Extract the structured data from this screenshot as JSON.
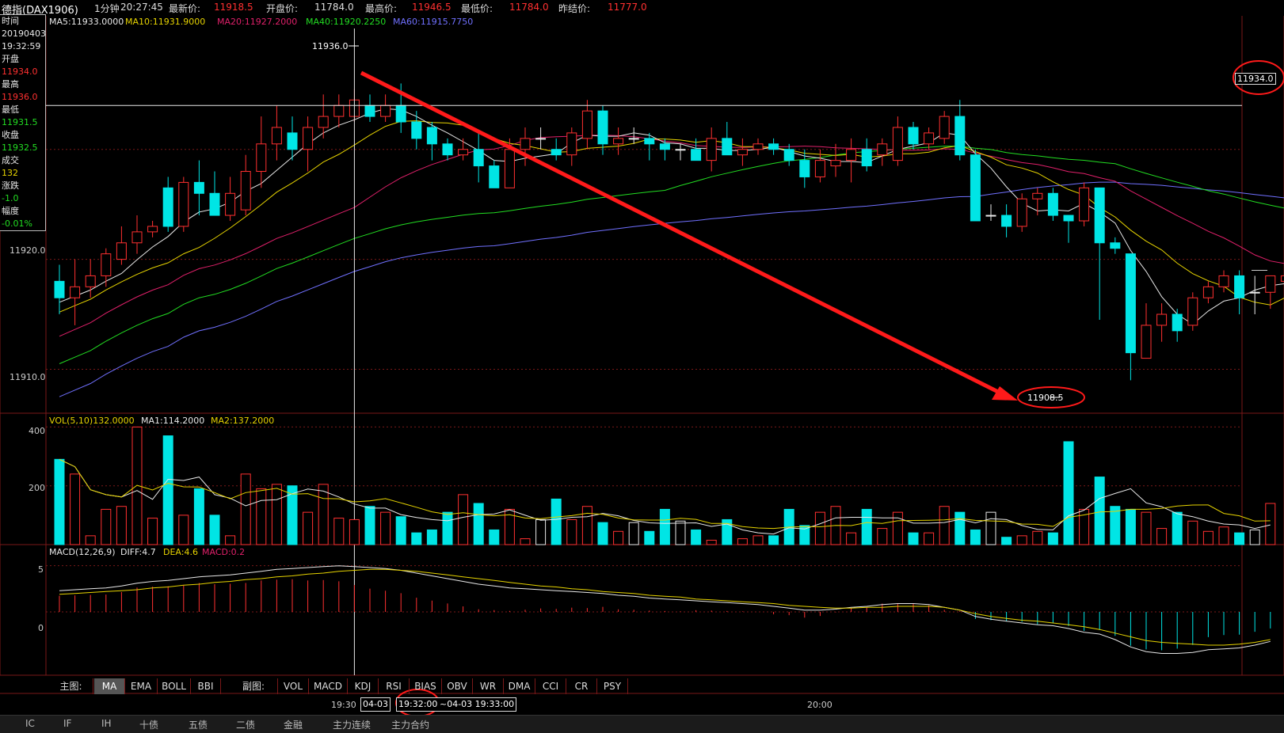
{
  "header": {
    "symbol": "德指(DAX1906)",
    "period": "1分钟",
    "time": "20:27:45",
    "latest_label": "最新价:",
    "latest": "11918.5",
    "open_label": "开盘价:",
    "open": "11784.0",
    "high_label": "最高价:",
    "high": "11946.5",
    "low_label": "最低价:",
    "low": "11784.0",
    "prev_label": "昨结价:",
    "prev": "11777.0"
  },
  "ma_legend": {
    "ma5": "MA5:11933.0000",
    "ma10": "MA10:11931.9000",
    "ma20": "MA20:11927.2000",
    "ma40": "MA40:11920.2250",
    "ma60": "MA60:11915.7750"
  },
  "info_box": {
    "time_label": "时间",
    "date": "20190403",
    "time": "19:32:59",
    "open_label": "开盘",
    "open": "11934.0",
    "high_label": "最高",
    "high": "11936.0",
    "low_label": "最低",
    "low": "11931.5",
    "close_label": "收盘",
    "close": "11932.5",
    "volume_label": "成交",
    "volume": "132",
    "change_label": "涨跌",
    "change": "-1.0",
    "pct_label": "幅度",
    "pct": "-0.01%"
  },
  "price_axis": [
    "11920.0",
    "11910.0"
  ],
  "annotations": {
    "high_tag": "11936.0",
    "low_tag": "11908.5",
    "cursor_price": "11934.0"
  },
  "vol_legend": {
    "vol": "VOL(5,10)132.0000",
    "ma1": "MA1:114.2000",
    "ma2": "MA2:137.2000"
  },
  "vol_axis": [
    "400",
    "200"
  ],
  "macd_legend": {
    "macd": "MACD(12,26,9)",
    "diff": "DIFF:4.7",
    "dea": "DEA:4.6",
    "macdv": "MACD:0.2"
  },
  "macd_axis": [
    "5",
    "0"
  ],
  "tabs": {
    "main_label": "主图:",
    "main": [
      "MA",
      "EMA",
      "BOLL",
      "BBI"
    ],
    "sub_label": "副图:",
    "sub": [
      "VOL",
      "MACD",
      "KDJ",
      "RSI",
      "BIAS",
      "OBV",
      "WR",
      "DMA",
      "CCI",
      "CR",
      "PSY"
    ]
  },
  "time_axis": {
    "t1": "19:30",
    "range_start_date": "04-03",
    "range_start_time": "19:32:00",
    "range_end": "~04-03 19:33:00",
    "t2": "20:00"
  },
  "statusbar": [
    "IC",
    "IF",
    "IH",
    "十债",
    "五债",
    "二债",
    "金融",
    "主力连续",
    "主力合约"
  ],
  "colors": {
    "up": "#ff3030",
    "down": "#00e5e5",
    "ma5": "#e8e8e8",
    "ma10": "#e6d300",
    "ma20": "#e0206a",
    "ma40": "#22dd22",
    "ma60": "#7070ff",
    "arrow": "#ff1a1a"
  },
  "chart_data": {
    "type": "candlestick",
    "candles": [
      {
        "o": 11918,
        "h": 11919.5,
        "l": 11915,
        "c": 11916.5
      },
      {
        "o": 11916.5,
        "h": 11920,
        "l": 11914,
        "c": 11917.5
      },
      {
        "o": 11917.5,
        "h": 11920,
        "l": 11916.5,
        "c": 11918.5
      },
      {
        "o": 11918.5,
        "h": 11921,
        "l": 11917.5,
        "c": 11920.5
      },
      {
        "o": 11920,
        "h": 11923,
        "l": 11919.5,
        "c": 11921.5
      },
      {
        "o": 11921.5,
        "h": 11924,
        "l": 11920.5,
        "c": 11922.5
      },
      {
        "o": 11922.5,
        "h": 11923.5,
        "l": 11922,
        "c": 11923
      },
      {
        "o": 11926.5,
        "h": 11927.5,
        "l": 11922.5,
        "c": 11923
      },
      {
        "o": 11923,
        "h": 11927.5,
        "l": 11922.5,
        "c": 11927
      },
      {
        "o": 11927,
        "h": 11929,
        "l": 11924,
        "c": 11926
      },
      {
        "o": 11926,
        "h": 11928,
        "l": 11924,
        "c": 11924
      },
      {
        "o": 11924,
        "h": 11927.5,
        "l": 11923.5,
        "c": 11926
      },
      {
        "o": 11924.5,
        "h": 11929.5,
        "l": 11924,
        "c": 11928
      },
      {
        "o": 11928,
        "h": 11933,
        "l": 11926.5,
        "c": 11930.5
      },
      {
        "o": 11930.5,
        "h": 11934,
        "l": 11929,
        "c": 11932
      },
      {
        "o": 11931.5,
        "h": 11933,
        "l": 11929,
        "c": 11930
      },
      {
        "o": 11930,
        "h": 11933,
        "l": 11928,
        "c": 11932
      },
      {
        "o": 11932,
        "h": 11935,
        "l": 11931,
        "c": 11933
      },
      {
        "o": 11933,
        "h": 11935,
        "l": 11932,
        "c": 11934
      },
      {
        "o": 11933,
        "h": 11935.5,
        "l": 11932.5,
        "c": 11934.5
      },
      {
        "o": 11934,
        "h": 11935,
        "l": 11932.5,
        "c": 11933
      },
      {
        "o": 11933,
        "h": 11935,
        "l": 11932.5,
        "c": 11934
      },
      {
        "o": 11934,
        "h": 11936,
        "l": 11931.5,
        "c": 11932.5
      },
      {
        "o": 11932.5,
        "h": 11933.5,
        "l": 11930,
        "c": 11931
      },
      {
        "o": 11932,
        "h": 11932.5,
        "l": 11929,
        "c": 11930.5
      },
      {
        "o": 11930.5,
        "h": 11931,
        "l": 11929,
        "c": 11929.5
      },
      {
        "o": 11929.5,
        "h": 11931,
        "l": 11929,
        "c": 11930
      },
      {
        "o": 11930,
        "h": 11931.5,
        "l": 11927,
        "c": 11928.5
      },
      {
        "o": 11928.5,
        "h": 11929,
        "l": 11926.5,
        "c": 11926.5
      },
      {
        "o": 11926.5,
        "h": 11931,
        "l": 11926.5,
        "c": 11930
      },
      {
        "o": 11930,
        "h": 11932,
        "l": 11928.5,
        "c": 11931
      },
      {
        "o": 11931,
        "h": 11932,
        "l": 11930,
        "c": 11931
      },
      {
        "o": 11930,
        "h": 11931,
        "l": 11929,
        "c": 11929.5
      },
      {
        "o": 11929.5,
        "h": 11932,
        "l": 11928.5,
        "c": 11931.5
      },
      {
        "o": 11931,
        "h": 11934.5,
        "l": 11930,
        "c": 11933.5
      },
      {
        "o": 11933.5,
        "h": 11934,
        "l": 11929.5,
        "c": 11930.5
      },
      {
        "o": 11930.5,
        "h": 11932,
        "l": 11929.5,
        "c": 11931
      },
      {
        "o": 11931,
        "h": 11932,
        "l": 11930.5,
        "c": 11931
      },
      {
        "o": 11931,
        "h": 11931.5,
        "l": 11929,
        "c": 11930.5
      },
      {
        "o": 11930.5,
        "h": 11931,
        "l": 11929,
        "c": 11930
      },
      {
        "o": 11930,
        "h": 11930.5,
        "l": 11929,
        "c": 11930
      },
      {
        "o": 11930,
        "h": 11931,
        "l": 11929.5,
        "c": 11929
      },
      {
        "o": 11929,
        "h": 11932,
        "l": 11928,
        "c": 11931
      },
      {
        "o": 11931,
        "h": 11932.5,
        "l": 11929.5,
        "c": 11929.5
      },
      {
        "o": 11929.5,
        "h": 11931,
        "l": 11928.5,
        "c": 11930
      },
      {
        "o": 11930,
        "h": 11931,
        "l": 11929.5,
        "c": 11930.5
      },
      {
        "o": 11930.5,
        "h": 11931,
        "l": 11929.5,
        "c": 11930
      },
      {
        "o": 11930,
        "h": 11930.5,
        "l": 11928.5,
        "c": 11929
      },
      {
        "o": 11929,
        "h": 11930,
        "l": 11926.5,
        "c": 11927.5
      },
      {
        "o": 11927.5,
        "h": 11930,
        "l": 11927,
        "c": 11929
      },
      {
        "o": 11928.5,
        "h": 11930.5,
        "l": 11927.5,
        "c": 11929
      },
      {
        "o": 11929,
        "h": 11931,
        "l": 11927,
        "c": 11930
      },
      {
        "o": 11930,
        "h": 11931,
        "l": 11928,
        "c": 11928.5
      },
      {
        "o": 11929.5,
        "h": 11931,
        "l": 11928.5,
        "c": 11930.5
      },
      {
        "o": 11929,
        "h": 11933,
        "l": 11928.5,
        "c": 11932
      },
      {
        "o": 11932,
        "h": 11932.5,
        "l": 11930,
        "c": 11930.5
      },
      {
        "o": 11930.5,
        "h": 11932,
        "l": 11930,
        "c": 11931.5
      },
      {
        "o": 11931,
        "h": 11933.5,
        "l": 11930.5,
        "c": 11933
      },
      {
        "o": 11933,
        "h": 11934.5,
        "l": 11929,
        "c": 11929.5
      },
      {
        "o": 11929.5,
        "h": 11930,
        "l": 11923.5,
        "c": 11923.5
      },
      {
        "o": 11924,
        "h": 11925,
        "l": 11923.5,
        "c": 11924
      },
      {
        "o": 11924,
        "h": 11925,
        "l": 11922,
        "c": 11923
      },
      {
        "o": 11923,
        "h": 11926,
        "l": 11922.5,
        "c": 11925.5
      },
      {
        "o": 11925.5,
        "h": 11926.5,
        "l": 11924,
        "c": 11926
      },
      {
        "o": 11926,
        "h": 11926.5,
        "l": 11923.5,
        "c": 11924
      },
      {
        "o": 11924,
        "h": 11924,
        "l": 11921.5,
        "c": 11923.5
      },
      {
        "o": 11923.5,
        "h": 11927,
        "l": 11923,
        "c": 11926.5
      },
      {
        "o": 11926.5,
        "h": 11926.5,
        "l": 11914.5,
        "c": 11921.5
      },
      {
        "o": 11921.5,
        "h": 11922,
        "l": 11920.5,
        "c": 11921
      },
      {
        "o": 11920.5,
        "h": 11920.5,
        "l": 11909,
        "c": 11911.5
      },
      {
        "o": 11911,
        "h": 11916,
        "l": 11911,
        "c": 11914
      },
      {
        "o": 11914,
        "h": 11916,
        "l": 11912.5,
        "c": 11915
      },
      {
        "o": 11915,
        "h": 11915.5,
        "l": 11912.5,
        "c": 11913.5
      },
      {
        "o": 11914,
        "h": 11917,
        "l": 11913.5,
        "c": 11916.5
      },
      {
        "o": 11916.5,
        "h": 11918,
        "l": 11916,
        "c": 11917.5
      },
      {
        "o": 11917.5,
        "h": 11919,
        "l": 11917,
        "c": 11918.5
      },
      {
        "o": 11918.5,
        "h": 11919,
        "l": 11915,
        "c": 11916.5
      },
      {
        "o": 11917,
        "h": 11918.5,
        "l": 11915,
        "c": 11917
      },
      {
        "o": 11917,
        "h": 11918.5,
        "l": 11915.5,
        "c": 11918.5
      },
      {
        "o": 11918,
        "h": 11919,
        "l": 11914,
        "c": 11918.5
      }
    ],
    "volume": [
      290,
      240,
      30,
      120,
      130,
      400,
      90,
      370,
      100,
      190,
      100,
      30,
      240,
      190,
      205,
      200,
      110,
      205,
      90,
      85,
      130,
      110,
      95,
      40,
      50,
      110,
      170,
      140,
      50,
      120,
      20,
      85,
      155,
      85,
      130,
      75,
      45,
      75,
      45,
      120,
      80,
      50,
      15,
      85,
      20,
      30,
      30,
      120,
      65,
      110,
      130,
      40,
      120,
      55,
      110,
      40,
      40,
      130,
      110,
      50,
      110,
      25,
      30,
      45,
      40,
      350,
      120,
      230,
      130,
      120,
      110,
      55,
      110,
      80,
      45,
      60,
      40,
      50,
      140
    ],
    "macd_diff": [
      2.3,
      2.4,
      2.5,
      2.6,
      2.8,
      3.1,
      3.3,
      3.4,
      3.6,
      3.8,
      3.9,
      4.0,
      4.2,
      4.4,
      4.6,
      4.7,
      4.8,
      4.9,
      5.0,
      4.9,
      4.8,
      4.7,
      4.5,
      4.2,
      3.9,
      3.6,
      3.3,
      3.0,
      2.8,
      2.6,
      2.5,
      2.4,
      2.3,
      2.2,
      2.1,
      2.0,
      1.8,
      1.7,
      1.5,
      1.4,
      1.3,
      1.2,
      1.1,
      1.0,
      0.9,
      0.8,
      0.6,
      0.4,
      0.2,
      0.2,
      0.3,
      0.5,
      0.6,
      0.8,
      0.9,
      0.9,
      0.8,
      0.5,
      0.2,
      -0.5,
      -0.8,
      -1.0,
      -1.2,
      -1.4,
      -1.5,
      -1.8,
      -2.2,
      -2.4,
      -3.0,
      -3.8,
      -4.3,
      -4.5,
      -4.5,
      -4.4,
      -4.1,
      -4.0,
      -3.9,
      -3.6,
      -3.2
    ],
    "macd_dea": [
      1.9,
      2.0,
      2.1,
      2.2,
      2.3,
      2.4,
      2.6,
      2.7,
      2.9,
      3.0,
      3.2,
      3.3,
      3.5,
      3.6,
      3.8,
      3.9,
      4.1,
      4.2,
      4.4,
      4.5,
      4.6,
      4.6,
      4.5,
      4.4,
      4.2,
      4.0,
      3.8,
      3.6,
      3.4,
      3.2,
      3.0,
      2.8,
      2.7,
      2.5,
      2.4,
      2.2,
      2.1,
      2.0,
      1.8,
      1.7,
      1.6,
      1.4,
      1.3,
      1.2,
      1.1,
      1.0,
      0.9,
      0.7,
      0.6,
      0.5,
      0.4,
      0.4,
      0.5,
      0.5,
      0.6,
      0.6,
      0.6,
      0.5,
      0.2,
      -0.2,
      -0.5,
      -0.7,
      -0.9,
      -1.0,
      -1.2,
      -1.4,
      -1.6,
      -1.9,
      -2.3,
      -2.7,
      -3.1,
      -3.3,
      -3.4,
      -3.5,
      -3.6,
      -3.6,
      -3.5,
      -3.3,
      -3.0
    ],
    "y_range": [
      11906,
      11941
    ],
    "vol_range": [
      0,
      420
    ],
    "macd_range": [
      -6,
      6
    ]
  }
}
